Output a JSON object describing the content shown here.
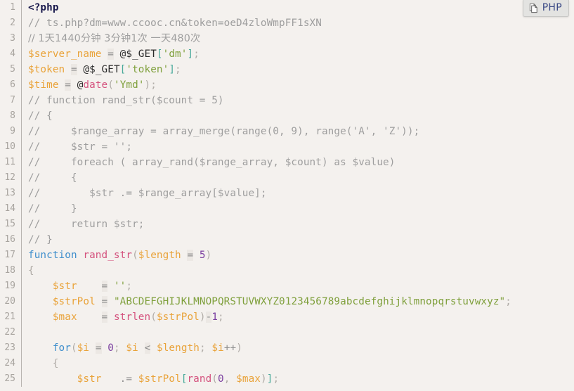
{
  "badge": {
    "label": "PHP",
    "icon": "copy-files-icon"
  },
  "editor": {
    "background": "#f4f1ee",
    "gutter_color": "#a8a49f",
    "first_line": 1,
    "last_line": 25,
    "language": "PHP"
  },
  "colors": {
    "string": "#7fa03c",
    "variable": "#e9a33a",
    "keyword": "#3e8ecc",
    "function": "#d4517d",
    "comment": "#9e9e9e",
    "number": "#7b3fa0",
    "bracket": "#48a99a",
    "background": "#f4f1ee",
    "badge_text": "#3b4a86"
  },
  "lines": [
    {
      "n": "1",
      "text": "<?php"
    },
    {
      "n": "2",
      "text": "// ts.php?dm=www.ccooc.cn&token=oeD4zloWmpFF1sXN"
    },
    {
      "n": "3",
      "text": "// 1天1440分钟 3分钟1次 一天480次"
    },
    {
      "n": "4",
      "text": "$server_name = @$_GET['dm'];"
    },
    {
      "n": "5",
      "text": "$token = @$_GET['token'];"
    },
    {
      "n": "6",
      "text": "$time = @date('Ymd');"
    },
    {
      "n": "7",
      "text": "// function rand_str($count = 5)"
    },
    {
      "n": "8",
      "text": "// {"
    },
    {
      "n": "9",
      "text": "//     $range_array = array_merge(range(0, 9), range('A', 'Z'));"
    },
    {
      "n": "10",
      "text": "//     $str = '';"
    },
    {
      "n": "11",
      "text": "//     foreach ( array_rand($range_array, $count) as $value)"
    },
    {
      "n": "12",
      "text": "//     {"
    },
    {
      "n": "13",
      "text": "//        $str .= $range_array[$value];"
    },
    {
      "n": "14",
      "text": "//     }"
    },
    {
      "n": "15",
      "text": "//     return $str;"
    },
    {
      "n": "16",
      "text": "// }"
    },
    {
      "n": "17",
      "text": "function rand_str($length = 5)"
    },
    {
      "n": "18",
      "text": "{"
    },
    {
      "n": "19",
      "text": "    $str    = '';"
    },
    {
      "n": "20",
      "text": "    $strPol = \"ABCDEFGHIJKLMNOPQRSTUVWXYZ0123456789abcdefghijklmnopqrstuvwxyz\";"
    },
    {
      "n": "21",
      "text": "    $max    = strlen($strPol)-1;"
    },
    {
      "n": "22",
      "text": ""
    },
    {
      "n": "23",
      "text": "    for($i = 0; $i < $length; $i++)"
    },
    {
      "n": "24",
      "text": "    {"
    },
    {
      "n": "25",
      "text": "        $str  .= $strPol[rand(0, $max)];"
    }
  ]
}
